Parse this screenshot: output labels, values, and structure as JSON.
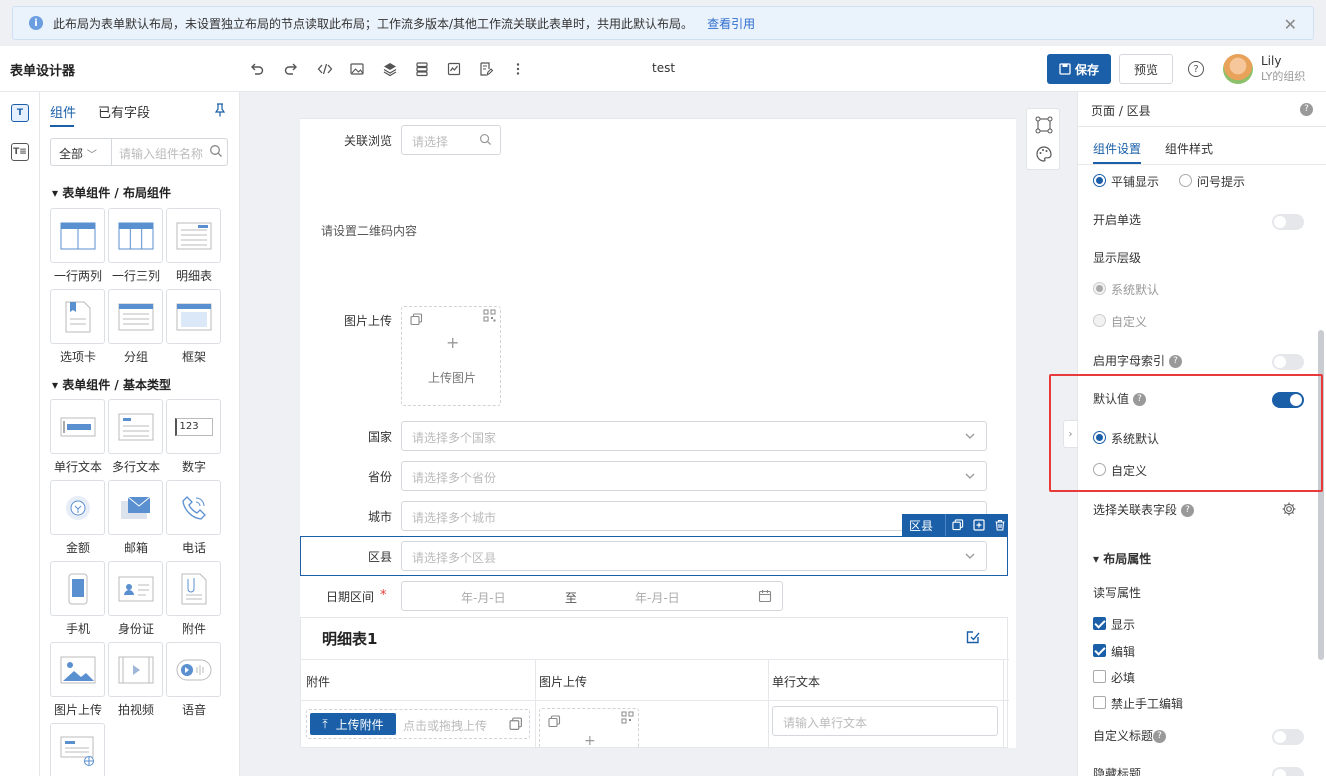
{
  "notice": {
    "text": "此布局为表单默认布局，未设置独立布局的节点读取此布局；工作流多版本/其他工作流关联此表单时，共用此默认布局。",
    "link": "查看引用"
  },
  "header": {
    "title": "表单设计器",
    "doc_name": "test",
    "save_label": "保存",
    "preview_label": "预览",
    "user_name": "Lily",
    "user_org": "LY的组织"
  },
  "rail": {
    "comp_icon": "T",
    "field_icon": "T≡"
  },
  "panel": {
    "tab_components": "组件",
    "tab_fields": "已有字段",
    "filter_value": "全部",
    "search_placeholder": "请输入组件名称",
    "section_layout": "表单组件 / 布局组件",
    "section_basic": "表单组件 / 基本类型",
    "layout_items": [
      {
        "label": "一行两列",
        "icon": "two-col-icon"
      },
      {
        "label": "一行三列",
        "icon": "three-col-icon"
      },
      {
        "label": "明细表",
        "icon": "detail-table-icon"
      },
      {
        "label": "选项卡",
        "icon": "tab-icon"
      },
      {
        "label": "分组",
        "icon": "group-icon"
      },
      {
        "label": "框架",
        "icon": "frame-icon"
      }
    ],
    "basic_items": [
      {
        "label": "单行文本",
        "icon": "single-text-icon"
      },
      {
        "label": "多行文本",
        "icon": "multi-text-icon"
      },
      {
        "label": "数字",
        "icon": "number-icon",
        "glyph": "123"
      },
      {
        "label": "金额",
        "icon": "money-icon"
      },
      {
        "label": "邮箱",
        "icon": "mail-icon"
      },
      {
        "label": "电话",
        "icon": "phone-icon"
      },
      {
        "label": "手机",
        "icon": "mobile-icon"
      },
      {
        "label": "身份证",
        "icon": "id-card-icon"
      },
      {
        "label": "附件",
        "icon": "attachment-icon"
      },
      {
        "label": "图片上传",
        "icon": "image-upload-icon"
      },
      {
        "label": "拍视频",
        "icon": "video-icon"
      },
      {
        "label": "语音",
        "icon": "voice-icon"
      },
      {
        "label": "",
        "icon": "web-field-icon"
      }
    ]
  },
  "canvas": {
    "assoc_label": "关联浏览",
    "assoc_placeholder": "请选择",
    "qr_text": "请设置二维码内容",
    "img_label": "图片上传",
    "img_upload_text": "上传图片",
    "country_label": "国家",
    "country_ph": "请选择多个国家",
    "province_label": "省份",
    "province_ph": "请选择多个省份",
    "city_label": "城市",
    "city_ph": "请选择多个城市",
    "district_label": "区县",
    "district_ph": "请选择多个区县",
    "selected_tag": "区县",
    "date_label": "日期区间",
    "required_mark": "*",
    "date_start": "年-月-日",
    "date_to": "至",
    "date_end": "年-月-日",
    "detail_title": "明细表1",
    "detail_cols": [
      "附件",
      "图片上传",
      "单行文本"
    ],
    "upload_btn": "上传附件",
    "upload_hint": "点击或拖拽上传",
    "text_ph": "请输入单行文本"
  },
  "rpanel": {
    "breadcrumb": "页面 / 区县",
    "tab_settings": "组件设置",
    "tab_style": "组件样式",
    "opt_tile": "平铺显示",
    "opt_question": "问号提示",
    "single_select": "开启单选",
    "show_level": "显示层级",
    "level_default": "系统默认",
    "level_custom": "自定义",
    "alpha_index": "启用字母索引",
    "default_value": "默认值",
    "dv_system": "系统默认",
    "dv_custom": "自定义",
    "link_field": "选择关联表字段",
    "layout_props": "布局属性",
    "rw_props": "读写属性",
    "cb_show": "显示",
    "cb_edit": "编辑",
    "cb_required": "必填",
    "cb_no_manual": "禁止手工编辑",
    "custom_title": "自定义标题",
    "hide_title": "隐藏标题",
    "accent": "#1a5fa8"
  }
}
